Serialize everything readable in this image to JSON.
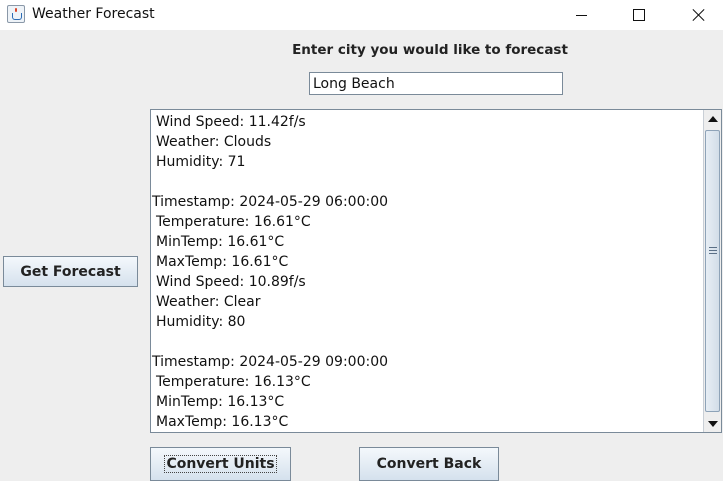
{
  "window": {
    "title": "Weather Forecast",
    "icon": "java-cup-icon"
  },
  "prompt": "Enter city you would like to forecast",
  "city_input": {
    "value": "Long Beach"
  },
  "buttons": {
    "get_forecast": "Get Forecast",
    "convert_units": "Convert Units",
    "convert_back": "Convert Back"
  },
  "forecast_lines": [
    "Wind Speed: 11.42f/s",
    "Weather: Clouds",
    "Humidity: 71",
    "",
    "Timestamp: 2024-05-29 06:00:00",
    "Temperature: 16.61°C",
    "MinTemp: 16.61°C",
    "MaxTemp: 16.61°C",
    "Wind Speed: 10.89f/s",
    "Weather: Clear",
    "Humidity: 80",
    "",
    "Timestamp: 2024-05-29 09:00:00",
    "Temperature: 16.13°C",
    "MinTemp: 16.13°C",
    "MaxTemp: 16.13°C"
  ],
  "scroll": {
    "position_fraction": 0.5
  }
}
